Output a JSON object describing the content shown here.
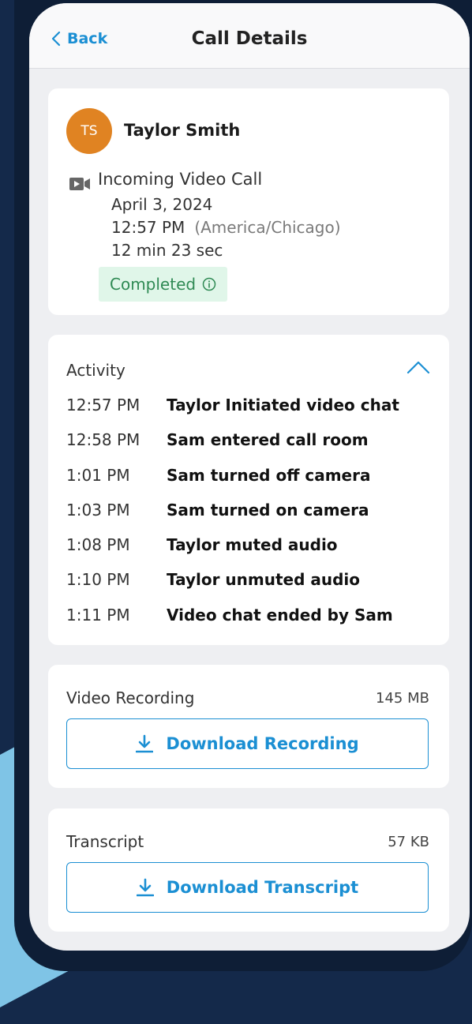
{
  "nav": {
    "back_label": "Back",
    "title": "Call Details"
  },
  "contact": {
    "initials": "TS",
    "name": "Taylor Smith",
    "avatar_color": "#e08322",
    "call_type": "Incoming Video Call",
    "call_icon": "video-camera-icon",
    "date": "April 3, 2024",
    "time": "12:57 PM",
    "timezone": "(America/Chicago)",
    "duration": "12 min 23 sec",
    "status": "Completed",
    "status_icon": "info-icon",
    "status_color": "#2f8a54"
  },
  "activity": {
    "heading": "Activity",
    "toggle_icon": "chevron-up-icon",
    "events": [
      {
        "time": "12:57 PM",
        "text": "Taylor Initiated video chat"
      },
      {
        "time": "12:58 PM",
        "text": "Sam entered call room"
      },
      {
        "time": "1:01 PM",
        "text": "Sam turned off camera"
      },
      {
        "time": "1:03 PM",
        "text": "Sam turned on camera"
      },
      {
        "time": "1:08 PM",
        "text": "Taylor muted audio"
      },
      {
        "time": "1:10 PM",
        "text": "Taylor unmuted audio"
      },
      {
        "time": "1:11 PM",
        "text": "Video chat ended by Sam"
      }
    ]
  },
  "recording": {
    "label": "Video Recording",
    "size": "145 MB",
    "button_label": "Download Recording",
    "button_icon": "download-icon"
  },
  "transcript": {
    "label": "Transcript",
    "size": "57 KB",
    "button_label": "Download Transcript",
    "button_icon": "download-icon"
  },
  "colors": {
    "accent": "#1b8fd3",
    "background": "#14294a",
    "screen": "#eeeff2"
  }
}
